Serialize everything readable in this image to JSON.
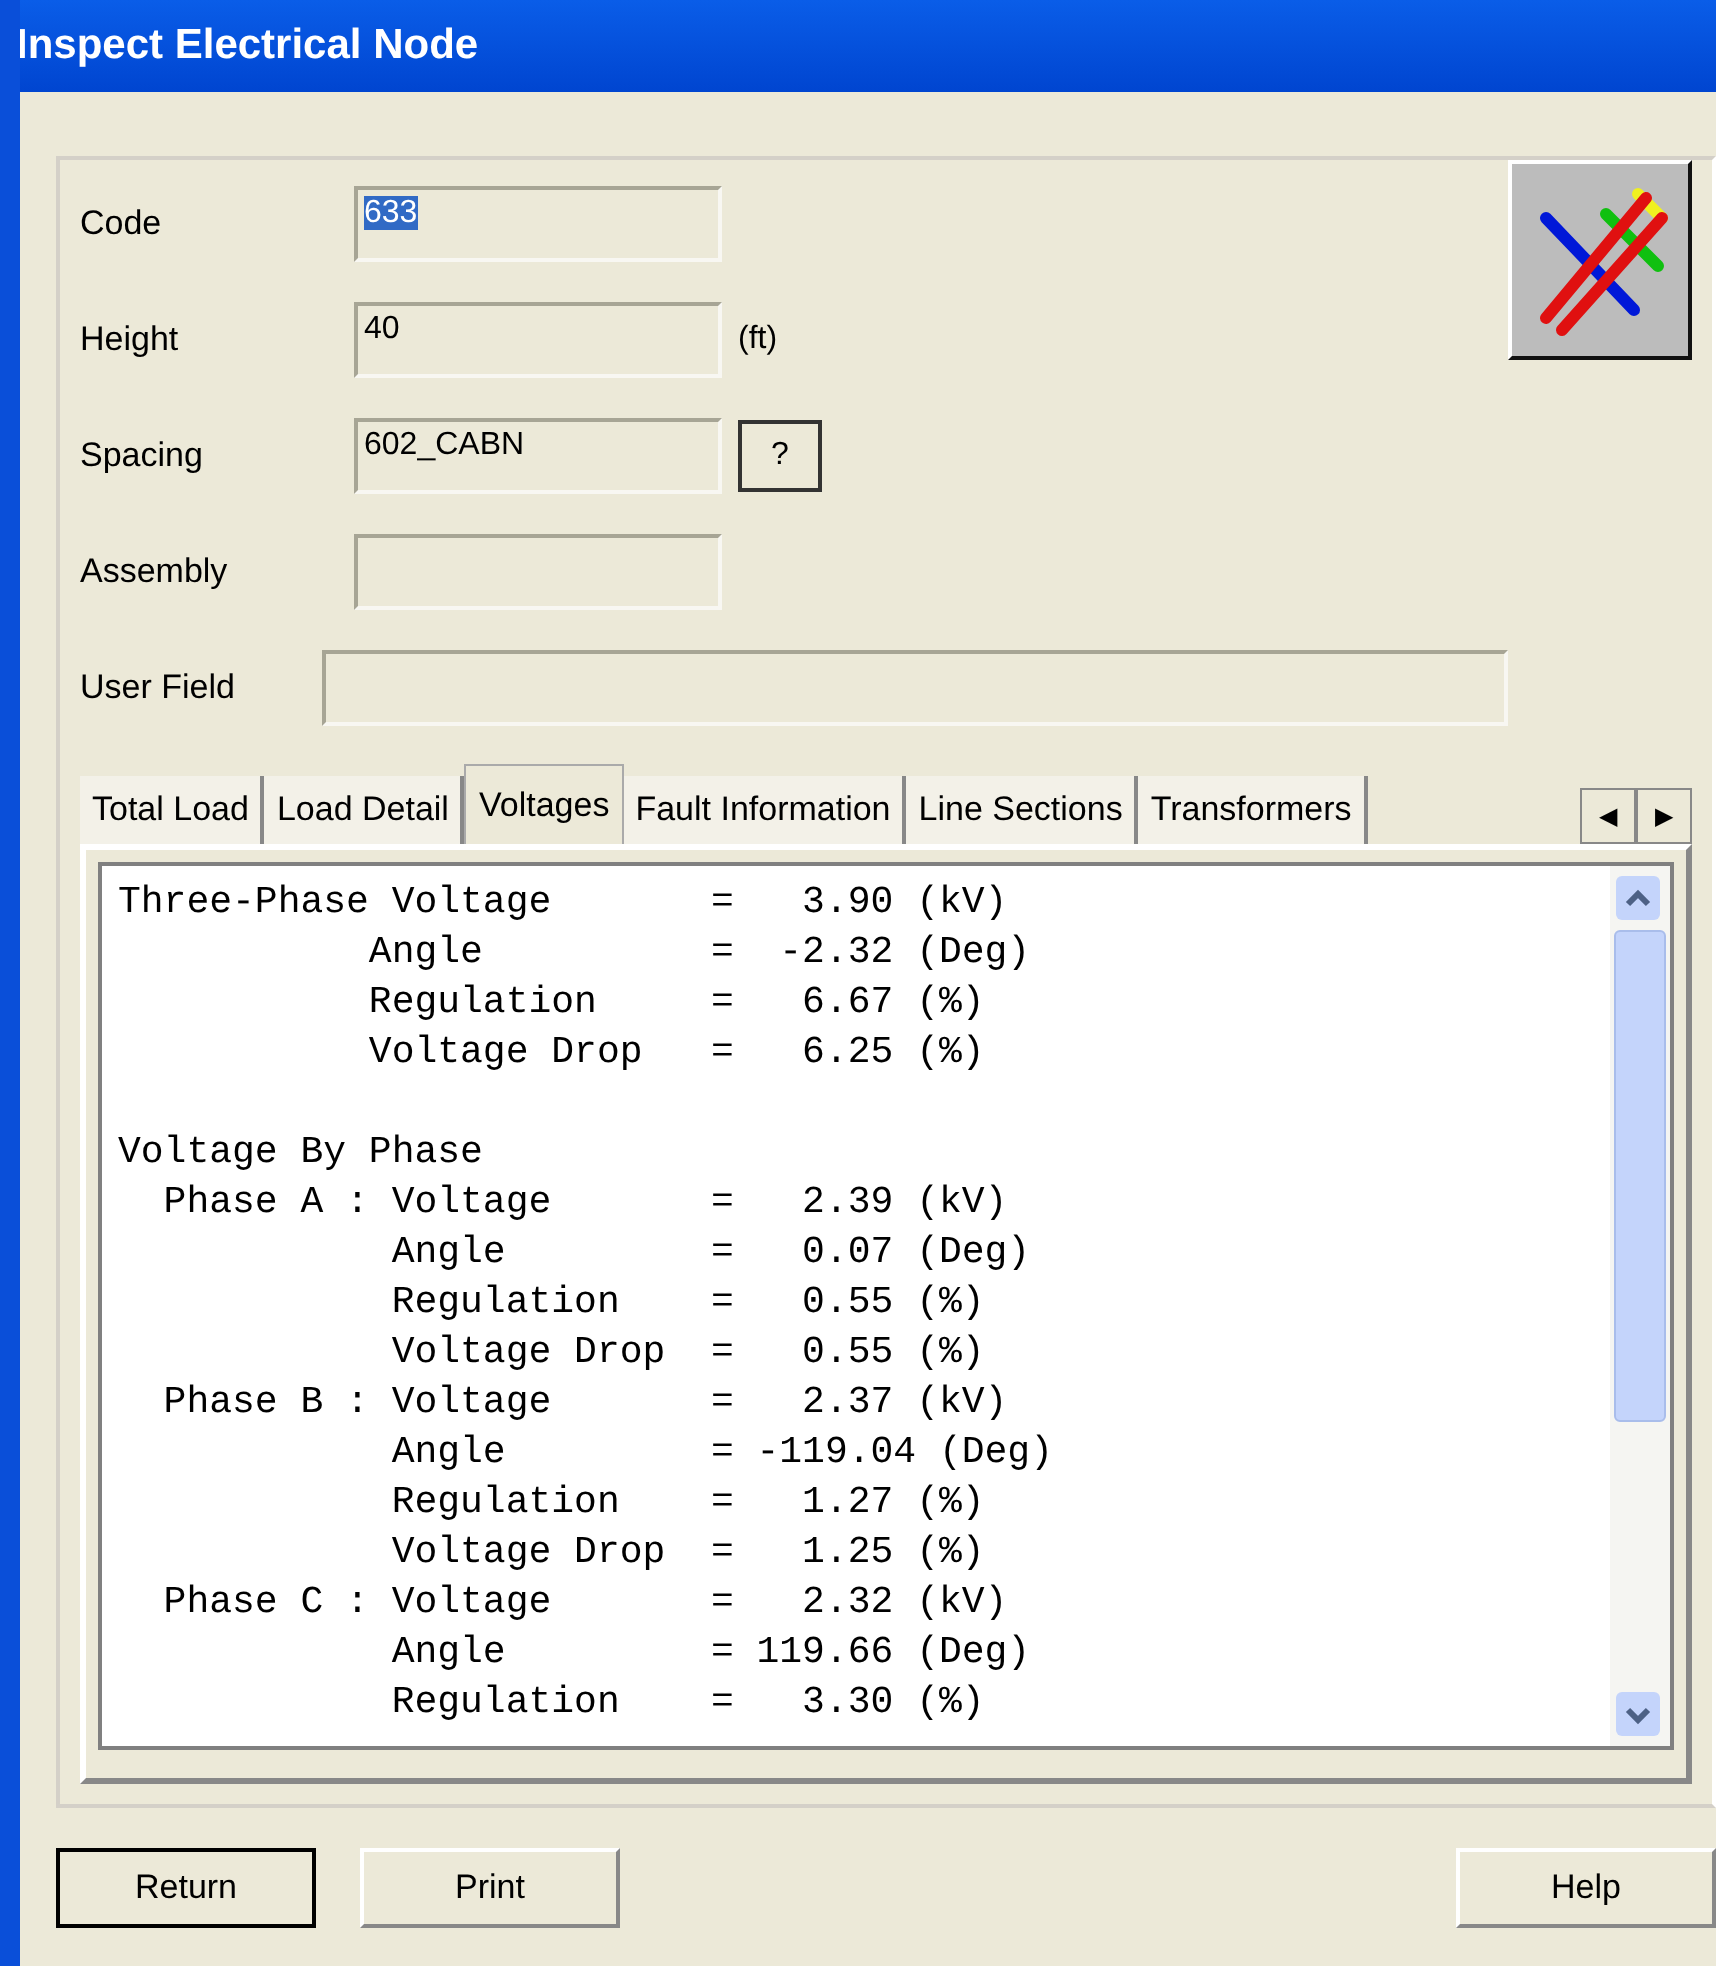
{
  "window": {
    "title": "Inspect Electrical Node"
  },
  "fields": [
    {
      "label": "Code",
      "value": "633",
      "text_selected": true,
      "kind": "short"
    },
    {
      "label": "Height",
      "value": "40",
      "unit": "(ft)",
      "kind": "short"
    },
    {
      "label": "Spacing",
      "value": "602_CABN",
      "action": "?",
      "kind": "short"
    },
    {
      "label": "Assembly",
      "kind": "short"
    },
    {
      "label": "User Field",
      "kind": "wide"
    }
  ],
  "tabs": [
    {
      "label": "Total Load",
      "selected": false
    },
    {
      "label": "Load Detail",
      "selected": false
    },
    {
      "label": "Voltages",
      "selected": true
    },
    {
      "label": "Fault Information",
      "selected": false
    },
    {
      "label": "Line Sections",
      "selected": false
    },
    {
      "label": "Transformers",
      "selected": false
    }
  ],
  "tab_scroll": [
    "◀",
    "▶"
  ],
  "report_lines": [
    "Three-Phase Voltage       =   3.90 (kV)",
    "           Angle          =  -2.32 (Deg)",
    "           Regulation     =   6.67 (%)",
    "           Voltage Drop   =   6.25 (%)",
    "Voltage By Phase",
    "  Phase A : Voltage       =   2.39 (kV)",
    "            Angle         =   0.07 (Deg)",
    "            Regulation    =   0.55 (%)",
    "            Voltage Drop  =   0.55 (%)",
    "  Phase B : Voltage       =   2.37 (kV)",
    "            Angle         = -119.04 (Deg)",
    "            Regulation    =   1.27 (%)",
    "            Voltage Drop  =   1.25 (%)",
    "  Phase C : Voltage       =   2.32 (kV)",
    "            Angle         = 119.66 (Deg)",
    "            Regulation    =   3.30 (%)"
  ],
  "buttons": [
    {
      "label": "Return",
      "kind": "default"
    },
    {
      "label": "Print",
      "kind": "normal"
    },
    {
      "label": "Help",
      "kind": "right"
    }
  ]
}
